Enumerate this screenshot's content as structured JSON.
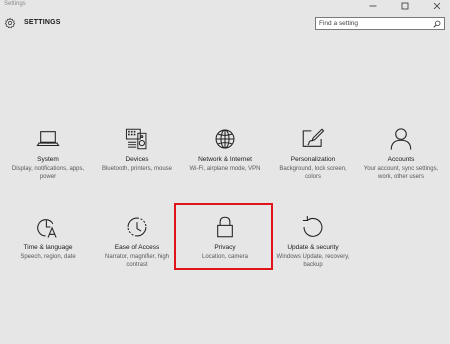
{
  "window": {
    "title": "Settings",
    "minimize_glyph": "—",
    "maximize_glyph": "□",
    "close_glyph": "✕"
  },
  "header": {
    "title": "SETTINGS",
    "icon": "gear-icon"
  },
  "search": {
    "placeholder": "Find a setting",
    "value": "",
    "icon": "search-icon"
  },
  "categories": [
    {
      "label": "System",
      "description": "Display, notifications, apps, power",
      "icon": "laptop-icon"
    },
    {
      "label": "Devices",
      "description": "Bluetooth, printers, mouse",
      "icon": "keyboard-speaker-icon"
    },
    {
      "label": "Network & Internet",
      "description": "Wi-Fi, airplane mode, VPN",
      "icon": "globe-icon"
    },
    {
      "label": "Personalization",
      "description": "Background, lock screen, colors",
      "icon": "paintbrush-icon"
    },
    {
      "label": "Accounts",
      "description": "Your account, sync settings, work, other users",
      "icon": "person-icon"
    },
    {
      "label": "Time & language",
      "description": "Speech, region, date",
      "icon": "clock-language-icon"
    },
    {
      "label": "Ease of Access",
      "description": "Narrator, magnifier, high contrast",
      "icon": "ease-of-access-icon"
    },
    {
      "label": "Privacy",
      "description": "Location, camera",
      "icon": "lock-icon"
    },
    {
      "label": "Update & security",
      "description": "Windows Update, recovery, backup",
      "icon": "refresh-icon"
    }
  ],
  "highlighted_category": "Privacy",
  "colors": {
    "background": "#e6e6e6",
    "highlight_border": "#e0151b",
    "text": "#1a1a1a",
    "secondary_text": "#595959"
  }
}
